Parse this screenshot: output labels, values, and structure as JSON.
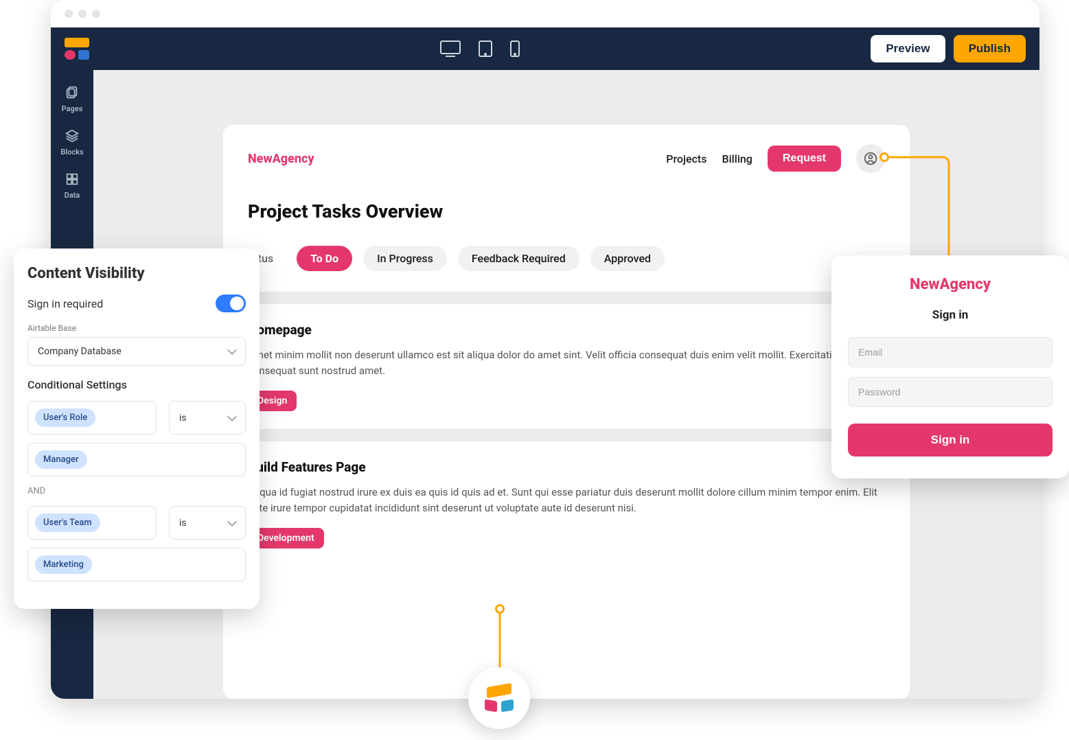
{
  "topbar": {
    "preview_label": "Preview",
    "publish_label": "Publish"
  },
  "rail": {
    "items": [
      {
        "label": "Pages"
      },
      {
        "label": "Blocks"
      },
      {
        "label": "Data"
      }
    ]
  },
  "preview": {
    "brand": "NewAgency",
    "nav": {
      "projects": "Projects",
      "billing": "Billing",
      "request": "Request"
    },
    "title": "Project Tasks Overview",
    "tabs": {
      "truncated": "atus",
      "items": [
        {
          "label": "To Do"
        },
        {
          "label": "In Progress"
        },
        {
          "label": "Feedback Required"
        },
        {
          "label": "Approved"
        }
      ],
      "active_index": 0
    },
    "tasks": [
      {
        "title": "Homepage",
        "desc": "Amet minim mollit non deserunt ullamco est sit aliqua dolor do amet sint. Velit officia consequat duis enim velit mollit. Exercitation veniam consequat sunt nostrud amet.",
        "tag": "Design"
      },
      {
        "title": "Build Features Page",
        "desc": "Aliqua id fugiat nostrud irure ex duis ea quis id quis ad et. Sunt qui esse pariatur duis deserunt mollit dolore cillum minim tempor enim. Elit aute irure tempor cupidatat incididunt sint deserunt ut voluptate aute id deserunt nisi.",
        "tag": "Development"
      }
    ]
  },
  "visibility": {
    "title": "Content Visibility",
    "signin_label": "Sign in required",
    "signin_enabled": true,
    "base_label": "Airtable Base",
    "base_value": "Company Database",
    "conditional_title": "Conditional Settings",
    "and_label": "AND",
    "conditions": [
      {
        "field": "User's Role",
        "op": "is",
        "value": "Manager"
      },
      {
        "field": "User's Team",
        "op": "is",
        "value": "Marketing"
      }
    ]
  },
  "signin": {
    "brand": "NewAgency",
    "heading": "Sign in",
    "email_placeholder": "Email",
    "password_placeholder": "Password",
    "button": "Sign in"
  }
}
